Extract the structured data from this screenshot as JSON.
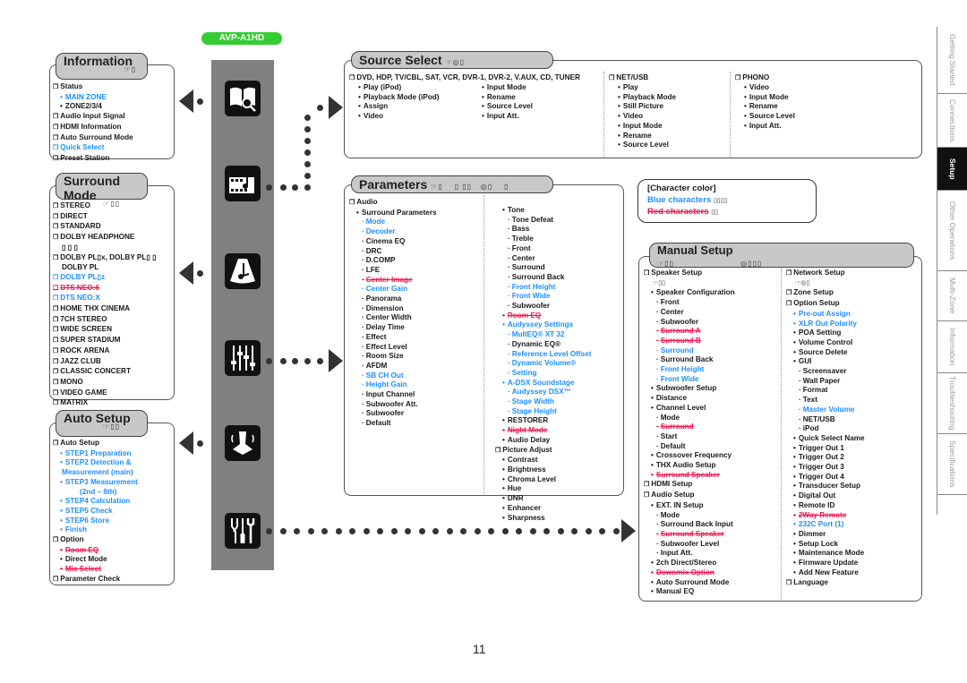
{
  "model_badge": "AVP-A1HD",
  "page_number": "11",
  "colors": {
    "blue_text": "#1e8fff",
    "red_text": "#f0154e",
    "badge_green": "#33cc33",
    "icon_bar": "#808080"
  },
  "information": {
    "title": "Information",
    "items": [
      {
        "text": "Status",
        "type": "box"
      },
      {
        "text": "MAIN ZONE",
        "type": "bul",
        "color": "blue"
      },
      {
        "text": "ZONE2/3/4",
        "type": "bul"
      },
      {
        "text": "Audio Input Signal",
        "type": "box"
      },
      {
        "text": "HDMI Information",
        "type": "box"
      },
      {
        "text": "Auto Surround Mode",
        "type": "box"
      },
      {
        "text": "Quick Select",
        "type": "box",
        "color": "blue"
      },
      {
        "text": "Preset Station",
        "type": "box"
      }
    ]
  },
  "surround_mode": {
    "title": "Surround Mode",
    "items": [
      {
        "text": "STEREO",
        "type": "box"
      },
      {
        "text": "DIRECT",
        "type": "box"
      },
      {
        "text": "STANDARD",
        "type": "box"
      },
      {
        "text": "DOLBY HEADPHONE",
        "type": "box"
      },
      {
        "text": "▯   ▯   ▯",
        "type": "ind"
      },
      {
        "text": "DOLBY PL▯x, DOLBY PL▯ ▯",
        "type": "box"
      },
      {
        "text": "DOLBY PL",
        "type": "ind"
      },
      {
        "text": "DOLBY PL▯z",
        "type": "box",
        "color": "blue"
      },
      {
        "text": "DTS NEO:6",
        "type": "box",
        "color": "red"
      },
      {
        "text": "DTS NEO:X",
        "type": "box",
        "color": "blue"
      },
      {
        "text": "HOME THX CINEMA",
        "type": "box"
      },
      {
        "text": "7CH STEREO",
        "type": "box"
      },
      {
        "text": "WIDE SCREEN",
        "type": "box"
      },
      {
        "text": "SUPER STADIUM",
        "type": "box"
      },
      {
        "text": "ROCK ARENA",
        "type": "box"
      },
      {
        "text": "JAZZ CLUB",
        "type": "box"
      },
      {
        "text": "CLASSIC CONCERT",
        "type": "box"
      },
      {
        "text": "MONO",
        "type": "box"
      },
      {
        "text": "VIDEO GAME",
        "type": "box"
      },
      {
        "text": "MATRIX",
        "type": "box"
      }
    ]
  },
  "auto_setup": {
    "title": "Auto Setup",
    "items": [
      {
        "text": "Auto Setup",
        "type": "box"
      },
      {
        "text": "STEP1 Preparation",
        "type": "bul",
        "color": "blue"
      },
      {
        "text": "STEP2 Detection &",
        "type": "bul",
        "color": "blue"
      },
      {
        "text": "Measurement (main)",
        "type": "ind",
        "color": "blue"
      },
      {
        "text": "STEP3 Measurement",
        "type": "bul",
        "color": "blue"
      },
      {
        "text": "(2nd – 8th)",
        "type": "ind2",
        "color": "blue"
      },
      {
        "text": "STEP4 Calculation",
        "type": "bul",
        "color": "blue"
      },
      {
        "text": "STEP5 Check",
        "type": "bul",
        "color": "blue"
      },
      {
        "text": "STEP6 Store",
        "type": "bul",
        "color": "blue"
      },
      {
        "text": "Finish",
        "type": "bul",
        "color": "blue"
      },
      {
        "text": "Option",
        "type": "box"
      },
      {
        "text": "Room EQ",
        "type": "bul",
        "color": "red"
      },
      {
        "text": "Direct Mode",
        "type": "bul"
      },
      {
        "text": "Mic Select",
        "type": "bul",
        "color": "red"
      },
      {
        "text": "Parameter Check",
        "type": "box"
      }
    ]
  },
  "source_select": {
    "title": "Source Select",
    "col1_header": "DVD, HDP, TV/CBL, SAT, VCR, DVR-1, DVR-2, V.AUX, CD, TUNER",
    "col1a": [
      "Play (iPod)",
      "Playback Mode (iPod)",
      "Assign",
      "Video"
    ],
    "col1b": [
      "Input Mode",
      "Rename",
      "Source Level",
      "Input Att."
    ],
    "col2_header": "NET/USB",
    "col2": [
      "Play",
      "Playback Mode",
      "Still Picture",
      "Video",
      "Input Mode",
      "Rename",
      "Source Level"
    ],
    "col3_header": "PHONO",
    "col3": [
      "Video",
      "Input Mode",
      "Rename",
      "Source Level",
      "Input Att."
    ]
  },
  "parameters": {
    "title": "Parameters",
    "col1": [
      {
        "text": "Audio",
        "type": "box"
      },
      {
        "text": "Surround Parameters",
        "type": "bul"
      },
      {
        "text": "Mode",
        "type": "sub",
        "color": "blue"
      },
      {
        "text": "Decoder",
        "type": "sub",
        "color": "blue"
      },
      {
        "text": "Cinema EQ",
        "type": "sub"
      },
      {
        "text": "DRC",
        "type": "sub"
      },
      {
        "text": "D.COMP",
        "type": "sub"
      },
      {
        "text": "LFE",
        "type": "sub"
      },
      {
        "text": "Center Image",
        "type": "sub",
        "color": "red"
      },
      {
        "text": "Center Gain",
        "type": "sub",
        "color": "blue"
      },
      {
        "text": "Panorama",
        "type": "sub"
      },
      {
        "text": "Dimension",
        "type": "sub"
      },
      {
        "text": "Center Width",
        "type": "sub"
      },
      {
        "text": "Delay Time",
        "type": "sub"
      },
      {
        "text": "Effect",
        "type": "sub"
      },
      {
        "text": "Effect Level",
        "type": "sub"
      },
      {
        "text": "Room Size",
        "type": "sub"
      },
      {
        "text": "AFDM",
        "type": "sub"
      },
      {
        "text": "SB CH Out",
        "type": "sub",
        "color": "blue"
      },
      {
        "text": "Height Gain",
        "type": "sub",
        "color": "blue"
      },
      {
        "text": "Input Channel",
        "type": "sub"
      },
      {
        "text": "Subwoofer Att.",
        "type": "sub"
      },
      {
        "text": "Subwoofer",
        "type": "sub"
      },
      {
        "text": "Default",
        "type": "sub"
      }
    ],
    "col2": [
      {
        "text": "Tone",
        "type": "bul"
      },
      {
        "text": "Tone Defeat",
        "type": "sub"
      },
      {
        "text": "Bass",
        "type": "sub"
      },
      {
        "text": "Treble",
        "type": "sub"
      },
      {
        "text": "Front",
        "type": "sub"
      },
      {
        "text": "Center",
        "type": "sub"
      },
      {
        "text": "Surround",
        "type": "sub"
      },
      {
        "text": "Surround Back",
        "type": "sub"
      },
      {
        "text": "Front Height",
        "type": "sub",
        "color": "blue"
      },
      {
        "text": "Front Wide",
        "type": "sub",
        "color": "blue"
      },
      {
        "text": "Subwoofer",
        "type": "sub"
      },
      {
        "text": "Room EQ",
        "type": "bul",
        "color": "red"
      },
      {
        "text": "Audyssey Settings",
        "type": "bul",
        "color": "blue"
      },
      {
        "text": "MultEQ® XT 32",
        "type": "sub",
        "color": "blue"
      },
      {
        "text": "Dynamic EQ®",
        "type": "sub"
      },
      {
        "text": "Reference Level Offset",
        "type": "sub",
        "color": "blue"
      },
      {
        "text": "Dynamic Volume®",
        "type": "sub",
        "color": "blue"
      },
      {
        "text": "Setting",
        "type": "sub",
        "color": "blue"
      },
      {
        "text": "A-DSX Soundstage",
        "type": "bul",
        "color": "blue"
      },
      {
        "text": "Audyssey DSX™",
        "type": "sub",
        "color": "blue"
      },
      {
        "text": "Stage Width",
        "type": "sub",
        "color": "blue"
      },
      {
        "text": "Stage Height",
        "type": "sub",
        "color": "blue"
      },
      {
        "text": "RESTORER",
        "type": "bul"
      },
      {
        "text": "Night Mode",
        "type": "bul",
        "color": "red"
      },
      {
        "text": "Audio Delay",
        "type": "bul"
      },
      {
        "text": "Picture Adjust",
        "type": "box"
      },
      {
        "text": "Contrast",
        "type": "bul"
      },
      {
        "text": "Brightness",
        "type": "bul"
      },
      {
        "text": "Chroma Level",
        "type": "bul"
      },
      {
        "text": "Hue",
        "type": "bul"
      },
      {
        "text": "DNR",
        "type": "bul"
      },
      {
        "text": "Enhancer",
        "type": "bul"
      },
      {
        "text": "Sharpness",
        "type": "bul"
      }
    ]
  },
  "legend": {
    "title": "[Character color]",
    "blue_label": "Blue characters",
    "red_label": "Red characters"
  },
  "manual_setup": {
    "title": "Manual Setup",
    "col1": [
      {
        "text": "Speaker Setup",
        "type": "box"
      },
      {
        "text": "☞▯▯",
        "type": "ind",
        "ref": true
      },
      {
        "text": "Speaker Configuration",
        "type": "bul"
      },
      {
        "text": "Front",
        "type": "sub"
      },
      {
        "text": "Center",
        "type": "sub"
      },
      {
        "text": "Subwoofer",
        "type": "sub"
      },
      {
        "text": "Surround A",
        "type": "sub",
        "color": "red"
      },
      {
        "text": "Surround B",
        "type": "sub",
        "color": "red"
      },
      {
        "text": "Surround",
        "type": "sub",
        "color": "blue"
      },
      {
        "text": "Surround Back",
        "type": "sub"
      },
      {
        "text": "Front Height",
        "type": "sub",
        "color": "blue"
      },
      {
        "text": "Front Wide",
        "type": "sub",
        "color": "blue"
      },
      {
        "text": "Subwoofer Setup",
        "type": "bul"
      },
      {
        "text": "Distance",
        "type": "bul"
      },
      {
        "text": "Channel Level",
        "type": "bul"
      },
      {
        "text": "Mode",
        "type": "sub"
      },
      {
        "text": "Surround",
        "type": "sub",
        "color": "red"
      },
      {
        "text": "Start",
        "type": "sub"
      },
      {
        "text": "Default",
        "type": "sub"
      },
      {
        "text": "Crossover Frequency",
        "type": "bul"
      },
      {
        "text": "THX Audio Setup",
        "type": "bul"
      },
      {
        "text": "Surround Speaker",
        "type": "bul",
        "color": "red"
      },
      {
        "text": "HDMI Setup",
        "type": "box"
      },
      {
        "text": "Audio Setup",
        "type": "box"
      },
      {
        "text": "EXT. IN Setup",
        "type": "bul"
      },
      {
        "text": "Mode",
        "type": "sub"
      },
      {
        "text": "Surround Back Input",
        "type": "sub"
      },
      {
        "text": "Surround Speaker",
        "type": "sub",
        "color": "red"
      },
      {
        "text": "Subwoofer Level",
        "type": "sub"
      },
      {
        "text": "Input Att.",
        "type": "sub"
      },
      {
        "text": "2ch Direct/Stereo",
        "type": "bul"
      },
      {
        "text": "Downmix Option",
        "type": "bul",
        "color": "red"
      },
      {
        "text": "Auto Surround Mode",
        "type": "bul"
      },
      {
        "text": "Manual EQ",
        "type": "bul"
      }
    ],
    "col2": [
      {
        "text": "Network Setup",
        "type": "box"
      },
      {
        "text": "☞◎▯",
        "type": "ind",
        "ref": true
      },
      {
        "text": "Zone Setup",
        "type": "box"
      },
      {
        "text": "Option Setup",
        "type": "box"
      },
      {
        "text": "Pre-out Assign",
        "type": "bul",
        "color": "blue"
      },
      {
        "text": "XLR Out Polarity",
        "type": "bul",
        "color": "blue"
      },
      {
        "text": "POA Setting",
        "type": "bul"
      },
      {
        "text": "Volume Control",
        "type": "bul"
      },
      {
        "text": "Source Delete",
        "type": "bul"
      },
      {
        "text": "GUI",
        "type": "bul"
      },
      {
        "text": "Screensaver",
        "type": "sub"
      },
      {
        "text": "Wall Paper",
        "type": "sub"
      },
      {
        "text": "Format",
        "type": "sub"
      },
      {
        "text": "Text",
        "type": "sub"
      },
      {
        "text": "Master Volume",
        "type": "sub",
        "color": "blue"
      },
      {
        "text": "NET/USB",
        "type": "sub"
      },
      {
        "text": "iPod",
        "type": "sub"
      },
      {
        "text": "Quick Select Name",
        "type": "bul"
      },
      {
        "text": "Trigger Out 1",
        "type": "bul"
      },
      {
        "text": "Trigger Out 2",
        "type": "bul"
      },
      {
        "text": "Trigger Out 3",
        "type": "bul"
      },
      {
        "text": "Trigger Out 4",
        "type": "bul"
      },
      {
        "text": "Transducer Setup",
        "type": "bul"
      },
      {
        "text": "Digital Out",
        "type": "bul"
      },
      {
        "text": "Remote ID",
        "type": "bul"
      },
      {
        "text": "2Way Remote",
        "type": "bul",
        "color": "red"
      },
      {
        "text": "232C Port (1)",
        "type": "bul",
        "color": "blue"
      },
      {
        "text": "Dimmer",
        "type": "bul"
      },
      {
        "text": "Setup Lock",
        "type": "bul"
      },
      {
        "text": "Maintenance Mode",
        "type": "bul"
      },
      {
        "text": "Firmware Update",
        "type": "bul"
      },
      {
        "text": "Add New Feature",
        "type": "bul"
      },
      {
        "text": "Language",
        "type": "box"
      }
    ]
  },
  "side_tabs": [
    {
      "label": "Getting Started",
      "active": false
    },
    {
      "label": "Connections",
      "active": false
    },
    {
      "label": "Setup",
      "active": true
    },
    {
      "label": "Other Operations",
      "active": false
    },
    {
      "label": "Multi-Zone",
      "active": false
    },
    {
      "label": "Information",
      "active": false
    },
    {
      "label": "Troubleshooting",
      "active": false
    },
    {
      "label": "Specifications",
      "active": false
    }
  ],
  "icons": [
    "information-book-icon",
    "source-select-film-icon",
    "surround-mode-icon",
    "parameters-slider-icon",
    "auto-setup-mic-icon",
    "manual-setup-tools-icon"
  ]
}
